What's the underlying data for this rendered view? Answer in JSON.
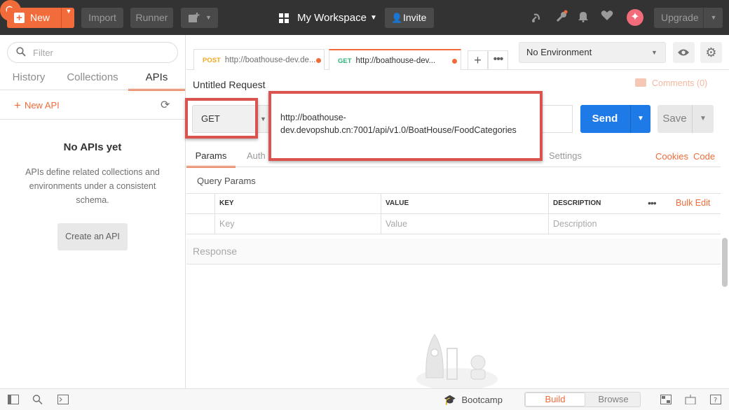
{
  "topbar": {
    "new_label": "New",
    "import_label": "Import",
    "runner_label": "Runner",
    "workspace_label": "My Workspace",
    "invite_label": "Invite",
    "upgrade_label": "Upgrade"
  },
  "sidebar": {
    "filter_placeholder": "Filter",
    "tabs": [
      {
        "label": "History"
      },
      {
        "label": "Collections"
      },
      {
        "label": "APIs"
      }
    ],
    "active_tab": "APIs",
    "new_api_label": "New API",
    "empty_title": "No APIs yet",
    "empty_description": "APIs define related collections and environments under a consistent schema.",
    "create_api_label": "Create an API"
  },
  "tabs": [
    {
      "method": "POST",
      "url": "http://boathouse-dev.de...",
      "method_color": "#f5a623"
    },
    {
      "method": "GET",
      "url": "http://boathouse-dev...",
      "method_color": "#2db37a"
    }
  ],
  "environment": {
    "selected": "No Environment"
  },
  "request": {
    "title": "Untitled Request",
    "comments_label": "Comments (0)",
    "method": "GET",
    "url_line1": "http://boathouse-",
    "url_line2": "dev.devopshub.cn:7001/api/v1.0/BoatHouse/FoodCategories",
    "send_label": "Send",
    "save_label": "Save"
  },
  "subtabs": {
    "params": "Params",
    "auth_partial": "Auth",
    "settings_partial": "Settings",
    "cookies": "Cookies",
    "code": "Code"
  },
  "query_params": {
    "title": "Query Params",
    "headers": [
      "KEY",
      "VALUE",
      "DESCRIPTION"
    ],
    "placeholders": [
      "Key",
      "Value",
      "Description"
    ],
    "bulk_edit": "Bulk Edit"
  },
  "response": {
    "label": "Response"
  },
  "statusbar": {
    "bootcamp_label": "Bootcamp",
    "build_label": "Build",
    "browse_label": "Browse"
  },
  "colors": {
    "accent": "#f26b3a",
    "send_blue": "#1e7ae6",
    "highlight_red": "#d9534f",
    "topbar_bg": "#333333"
  }
}
